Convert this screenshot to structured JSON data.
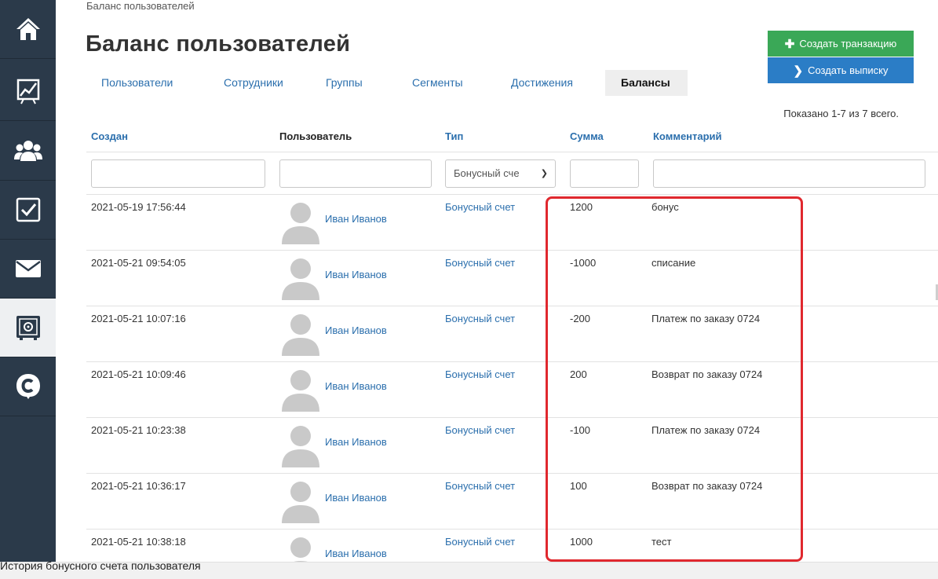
{
  "sidebar": {
    "items": [
      {
        "icon": "home-icon"
      },
      {
        "icon": "chart-icon"
      },
      {
        "icon": "users-icon"
      },
      {
        "icon": "checkbox-icon"
      },
      {
        "icon": "mail-icon"
      },
      {
        "icon": "safe-icon",
        "active": true
      },
      {
        "icon": "brand-logo-icon"
      }
    ]
  },
  "breadcrumb": "Баланс пользователей",
  "page_title": "Баланс пользователей",
  "actions": {
    "create_transaction": "Создать транзакцию",
    "create_statement": "Создать выписку"
  },
  "tabs": [
    {
      "label": "Пользователи"
    },
    {
      "label": "Сотрудники"
    },
    {
      "label": "Группы"
    },
    {
      "label": "Сегменты"
    },
    {
      "label": "Достижения"
    },
    {
      "label": "Балансы",
      "active": true
    }
  ],
  "summary": "Показано 1-7 из 7 всего.",
  "table": {
    "columns": {
      "created": "Создан",
      "user": "Пользователь",
      "type": "Тип",
      "amount": "Сумма",
      "comment": "Комментарий"
    },
    "filters": {
      "type_selected": "Бонусный сче"
    },
    "rows": [
      {
        "created": "2021-05-19 17:56:44",
        "user": "Иван Иванов",
        "type": "Бонусный счет",
        "amount": "1200",
        "comment": "бонус"
      },
      {
        "created": "2021-05-21 09:54:05",
        "user": "Иван Иванов",
        "type": "Бонусный счет",
        "amount": "-1000",
        "comment": "списание"
      },
      {
        "created": "2021-05-21 10:07:16",
        "user": "Иван Иванов",
        "type": "Бонусный счет",
        "amount": "-200",
        "comment": "Платеж по заказу 0724"
      },
      {
        "created": "2021-05-21 10:09:46",
        "user": "Иван Иванов",
        "type": "Бонусный счет",
        "amount": "200",
        "comment": "Возврат по заказу 0724"
      },
      {
        "created": "2021-05-21 10:23:38",
        "user": "Иван Иванов",
        "type": "Бонусный счет",
        "amount": "-100",
        "comment": "Платеж по заказу 0724"
      },
      {
        "created": "2021-05-21 10:36:17",
        "user": "Иван Иванов",
        "type": "Бонусный счет",
        "amount": "100",
        "comment": "Возврат по заказу 0724"
      },
      {
        "created": "2021-05-21 10:38:18",
        "user": "Иван Иванов",
        "type": "Бонусный счет",
        "amount": "1000",
        "comment": "тест"
      }
    ]
  },
  "caption": "История бонусного счета пользователя",
  "colors": {
    "sidebar_bg": "#2b3a4a",
    "link": "#2b6fad",
    "green_button": "#3aa857",
    "blue_button": "#2b7dc6",
    "highlight": "#e0282e"
  }
}
